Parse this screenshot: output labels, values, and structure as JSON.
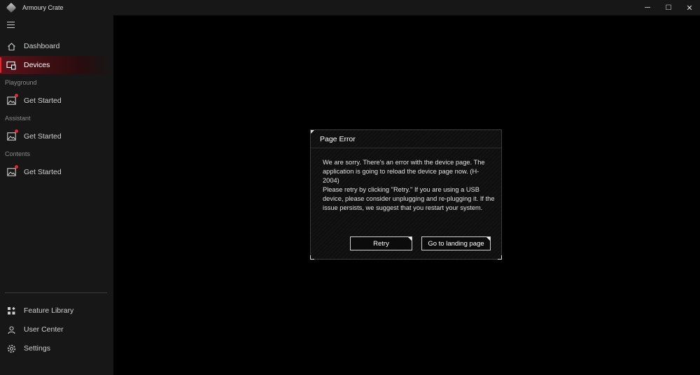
{
  "window": {
    "title": "Armoury Crate",
    "minimize_glyph": "─",
    "maximize_glyph": "☐",
    "close_glyph": "✕"
  },
  "sidebar": {
    "main_items": [
      {
        "label": "Dashboard",
        "icon": "home-icon"
      },
      {
        "label": "Devices",
        "icon": "devices-icon",
        "active": true
      }
    ],
    "sections": [
      {
        "label": "Playground",
        "item": {
          "label": "Get Started",
          "icon": "image-icon",
          "badge": true
        }
      },
      {
        "label": "Assistant",
        "item": {
          "label": "Get Started",
          "icon": "image-icon",
          "badge": true
        }
      },
      {
        "label": "Contents",
        "item": {
          "label": "Get Started",
          "icon": "image-icon",
          "badge": true
        }
      }
    ],
    "bottom_items": [
      {
        "label": "Feature Library",
        "icon": "feature-library-icon"
      },
      {
        "label": "User Center",
        "icon": "user-center-icon"
      },
      {
        "label": "Settings",
        "icon": "gear-icon"
      }
    ]
  },
  "dialog": {
    "title": "Page Error",
    "message_1": "We are sorry. There's an error with the device page. The application is going to reload the device page now. (H-2004)",
    "message_2": "Please retry by clicking \"Retry.\" If you are using a USB device, please consider unplugging and re-plugging it. If the issue persists, we suggest that you restart your system.",
    "retry_label": "Retry",
    "landing_label": "Go to landing page"
  },
  "colors": {
    "accent": "#e0252f",
    "sidebar_bg": "#171717",
    "main_bg": "#000000"
  }
}
